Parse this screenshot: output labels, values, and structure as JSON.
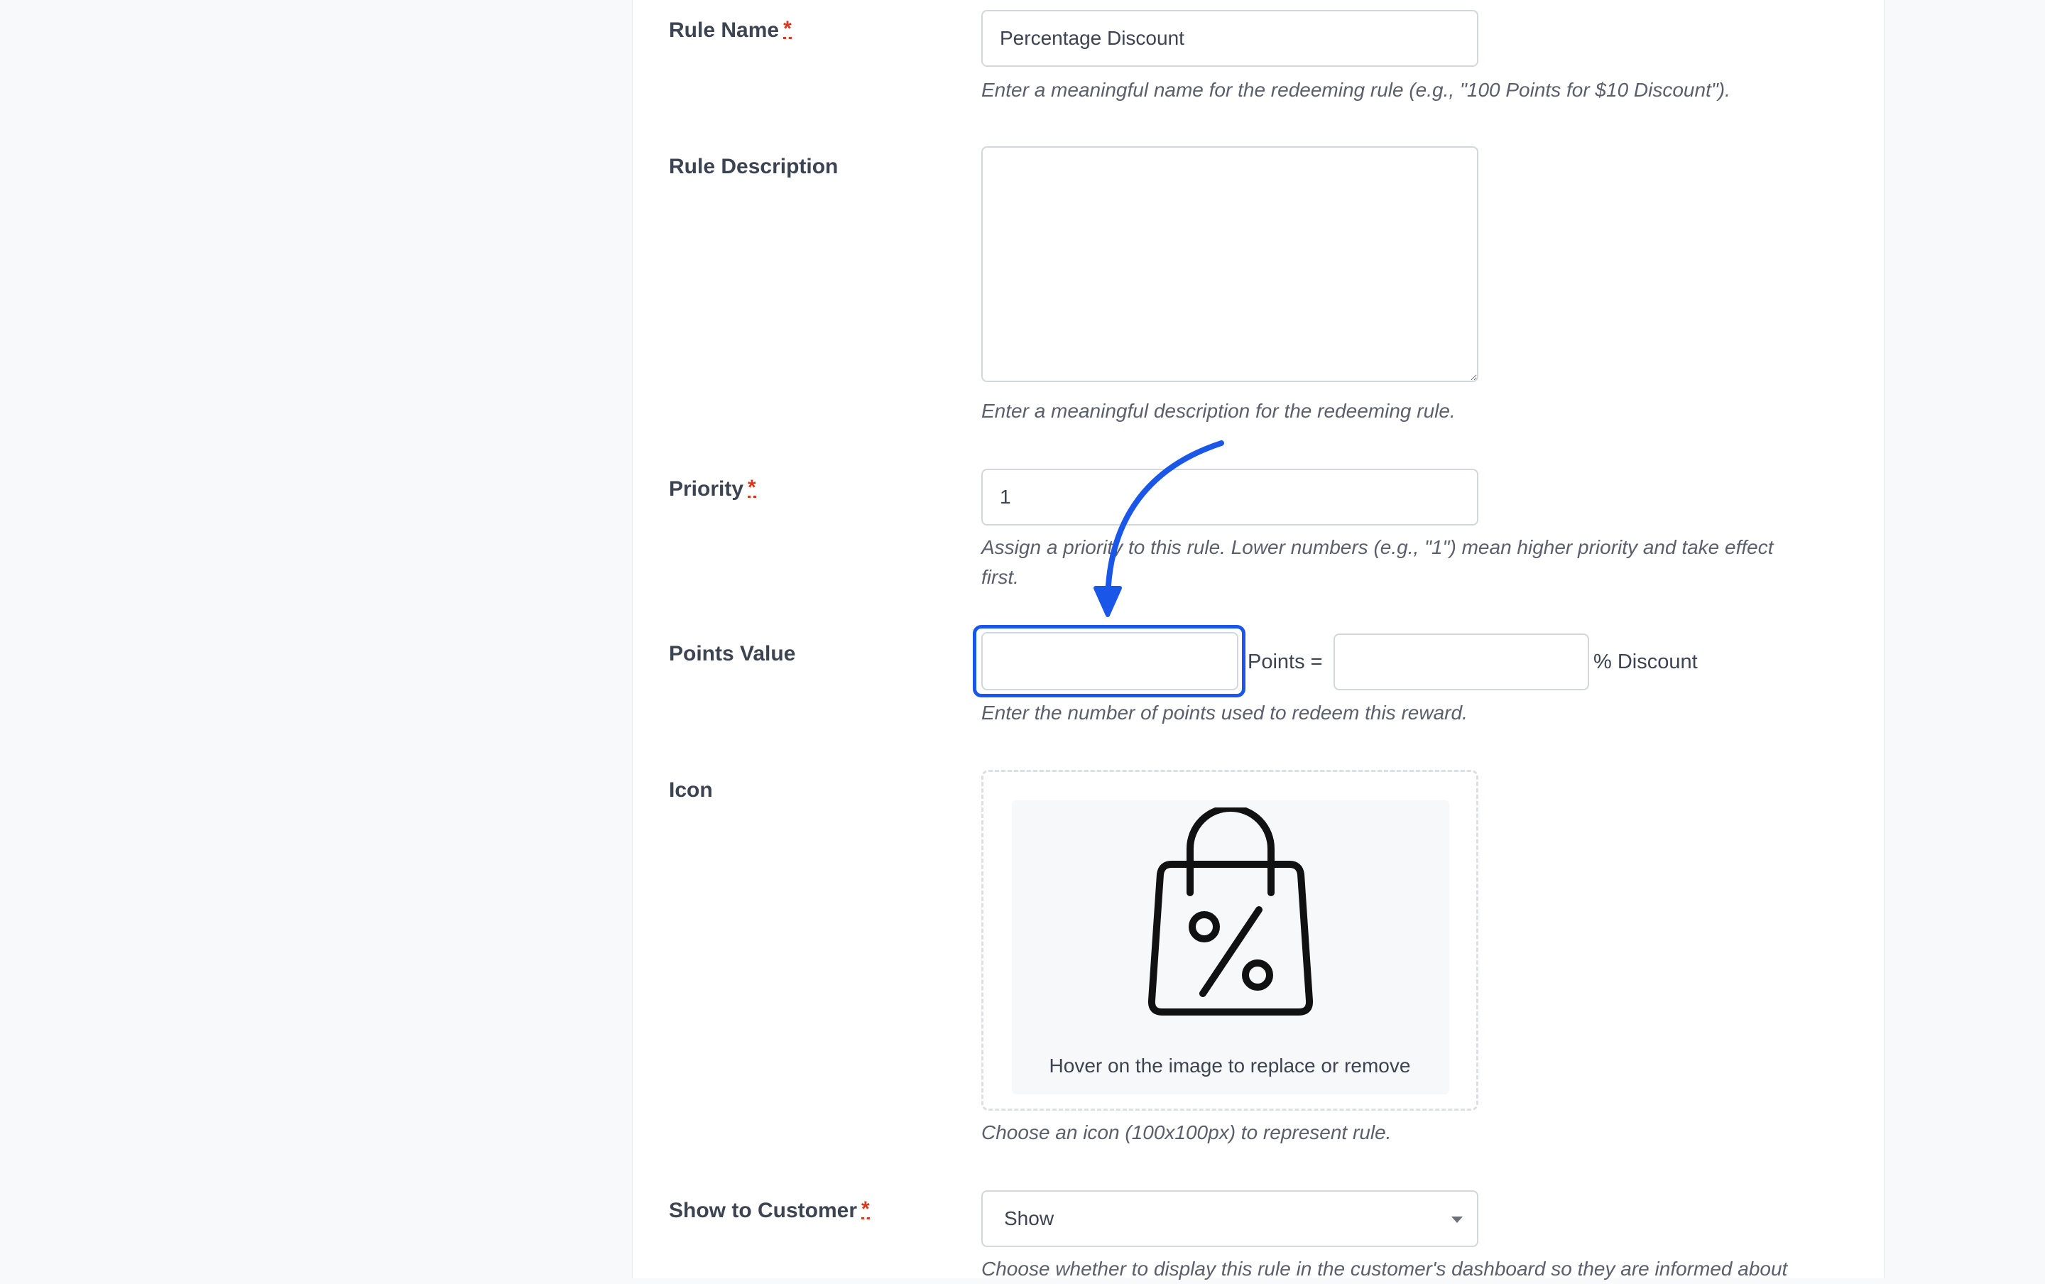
{
  "rule_name": {
    "label": "Rule Name",
    "required_mark": "*",
    "value": "Percentage Discount",
    "help": "Enter a meaningful name for the redeeming rule (e.g., \"100 Points for $10 Discount\")."
  },
  "rule_description": {
    "label": "Rule Description",
    "value": "",
    "help": "Enter a meaningful description for the redeeming rule."
  },
  "priority": {
    "label": "Priority",
    "required_mark": "*",
    "value": "1",
    "help_line1": "Assign a priority to this rule. Lower numbers (e.g., \"1\") mean higher priority and take effect",
    "help_line2": "first."
  },
  "points_value": {
    "label": "Points Value",
    "points_value": "",
    "points_suffix": "Points =",
    "discount_value": "",
    "discount_suffix": "% Discount",
    "help": "Enter the number of points used to redeem this reward."
  },
  "icon": {
    "label": "Icon",
    "image": "shopping-bag-percent-icon",
    "caption": "Hover on the image to replace or remove",
    "help": "Choose an icon (100x100px) to represent rule."
  },
  "show_to_customer": {
    "label": "Show to Customer",
    "required_mark": "*",
    "selected": "Show",
    "help": "Choose whether to display this rule in the customer's dashboard so they are informed about"
  },
  "colors": {
    "highlight": "#1a56e8",
    "required": "#d9381e"
  }
}
